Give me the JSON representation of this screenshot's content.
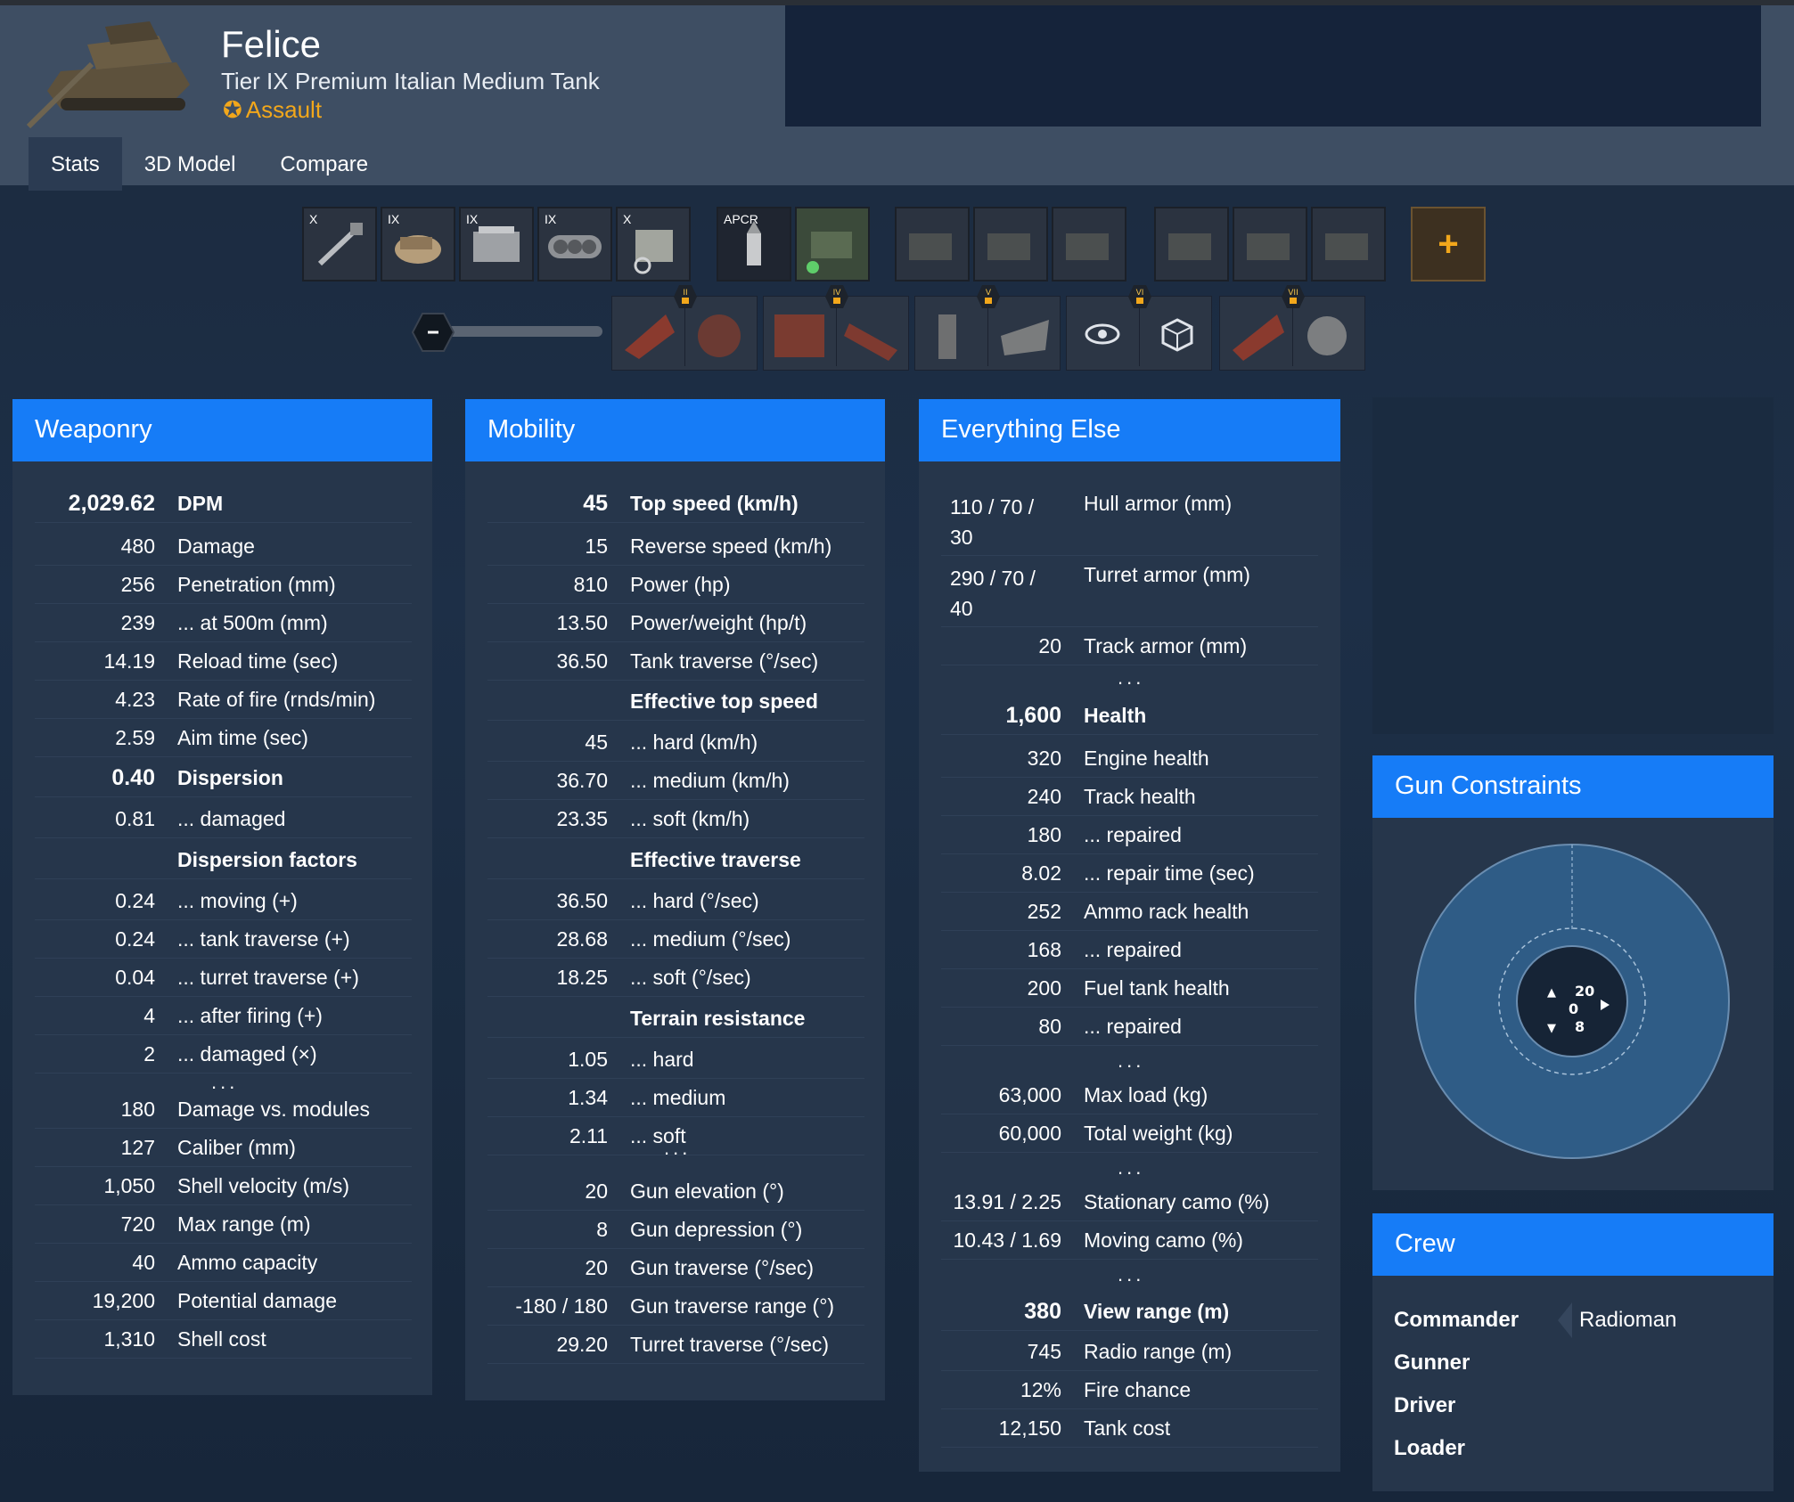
{
  "header": {
    "name": "Felice",
    "subtitle": "Tier IX Premium Italian Medium Tank",
    "role": "Assault"
  },
  "tabs": [
    "Stats",
    "3D Model",
    "Compare"
  ],
  "loadout": {
    "modules": [
      {
        "tier": "X",
        "icon": "gun-icon"
      },
      {
        "tier": "IX",
        "icon": "turret-icon"
      },
      {
        "tier": "IX",
        "icon": "engine-icon"
      },
      {
        "tier": "IX",
        "icon": "suspension-icon"
      },
      {
        "tier": "X",
        "icon": "radio-icon"
      }
    ],
    "shell": {
      "label": "APCR",
      "icon": "shell-icon"
    },
    "consumable_slots": 7,
    "add_label": "+",
    "skill_badges": [
      "II",
      "IV",
      "V",
      "VI",
      "VII"
    ]
  },
  "weaponry": {
    "title": "Weaponry",
    "rows": [
      {
        "v": "2,029.62",
        "l": "DPM",
        "b": true
      },
      {
        "v": "480",
        "l": "Damage"
      },
      {
        "v": "256",
        "l": "Penetration (mm)"
      },
      {
        "v": "239",
        "l": "... at 500m (mm)"
      },
      {
        "v": "14.19",
        "l": "Reload time (sec)"
      },
      {
        "v": "4.23",
        "l": "Rate of fire (rnds/min)"
      },
      {
        "v": "2.59",
        "l": "Aim time (sec)"
      },
      {
        "v": "0.40",
        "l": "Dispersion",
        "b": true
      },
      {
        "v": "0.81",
        "l": "... damaged"
      },
      {
        "v": "",
        "l": "Dispersion factors",
        "b": true
      },
      {
        "v": "0.24",
        "l": "... moving (+)"
      },
      {
        "v": "0.24",
        "l": "... tank traverse (+)"
      },
      {
        "v": "0.04",
        "l": "... turret traverse (+)"
      },
      {
        "v": "4",
        "l": "... after firing (+)"
      },
      {
        "v": "2",
        "l": "... damaged (×)"
      },
      {
        "v": "180",
        "l": "Damage vs. modules"
      },
      {
        "v": "127",
        "l": "Caliber (mm)"
      },
      {
        "v": "1,050",
        "l": "Shell velocity (m/s)"
      },
      {
        "v": "720",
        "l": "Max range (m)"
      },
      {
        "v": "40",
        "l": "Ammo capacity"
      },
      {
        "v": "19,200",
        "l": "Potential damage"
      },
      {
        "v": "1,310",
        "l": "Shell cost"
      }
    ]
  },
  "mobility": {
    "title": "Mobility",
    "rows": [
      {
        "v": "45",
        "l": "Top speed (km/h)",
        "b": true
      },
      {
        "v": "15",
        "l": "Reverse speed (km/h)"
      },
      {
        "v": "810",
        "l": "Power (hp)"
      },
      {
        "v": "13.50",
        "l": "Power/weight (hp/t)"
      },
      {
        "v": "36.50",
        "l": "Tank traverse (°/sec)"
      },
      {
        "v": "",
        "l": "Effective top speed",
        "b": true
      },
      {
        "v": "45",
        "l": "... hard (km/h)"
      },
      {
        "v": "36.70",
        "l": "... medium (km/h)"
      },
      {
        "v": "23.35",
        "l": "... soft (km/h)"
      },
      {
        "v": "",
        "l": "Effective traverse",
        "b": true
      },
      {
        "v": "36.50",
        "l": "... hard (°/sec)"
      },
      {
        "v": "28.68",
        "l": "... medium (°/sec)"
      },
      {
        "v": "18.25",
        "l": "... soft (°/sec)"
      },
      {
        "v": "",
        "l": "Terrain resistance",
        "b": true
      },
      {
        "v": "1.05",
        "l": "... hard"
      },
      {
        "v": "1.34",
        "l": "... medium"
      },
      {
        "v": "2.11",
        "l": "... soft"
      },
      {
        "v": "20",
        "l": "Gun elevation (°)"
      },
      {
        "v": "8",
        "l": "Gun depression (°)"
      },
      {
        "v": "20",
        "l": "Gun traverse (°/sec)"
      },
      {
        "v": "-180 / 180",
        "l": "Gun traverse range (°)"
      },
      {
        "v": "29.20",
        "l": "Turret traverse (°/sec)"
      }
    ]
  },
  "else": {
    "title": "Everything Else",
    "rows": [
      {
        "v": "110 / 70 /",
        "v2": "30",
        "l": "Hull armor (mm)"
      },
      {
        "v": "290 / 70 /",
        "v2": "40",
        "l": "Turret armor (mm)"
      },
      {
        "v": "20",
        "l": "Track armor (mm)"
      },
      {
        "v": "1,600",
        "l": "Health",
        "b": true
      },
      {
        "v": "320",
        "l": "Engine health"
      },
      {
        "v": "240",
        "l": "Track health"
      },
      {
        "v": "180",
        "l": "... repaired"
      },
      {
        "v": "8.02",
        "l": "... repair time (sec)"
      },
      {
        "v": "252",
        "l": "Ammo rack health"
      },
      {
        "v": "168",
        "l": "... repaired"
      },
      {
        "v": "200",
        "l": "Fuel tank health"
      },
      {
        "v": "80",
        "l": "... repaired"
      },
      {
        "v": "63,000",
        "l": "Max load (kg)"
      },
      {
        "v": "60,000",
        "l": "Total weight (kg)"
      },
      {
        "v": "13.91 / 2.25",
        "l": "Stationary camo (%)"
      },
      {
        "v": "10.43 / 1.69",
        "l": "Moving camo (%)"
      },
      {
        "v": "380",
        "l": "View range (m)",
        "b": true
      },
      {
        "v": "745",
        "l": "Radio range (m)"
      },
      {
        "v": "12%",
        "l": "Fire chance"
      },
      {
        "v": "12,150",
        "l": "Tank cost"
      }
    ]
  },
  "gun_constraints": {
    "title": "Gun Constraints",
    "elevation": "20",
    "center": "0",
    "depression": "8"
  },
  "crew": {
    "title": "Crew",
    "roles": [
      "Commander",
      "Gunner",
      "Driver",
      "Loader"
    ],
    "commander_extra": "Radioman"
  },
  "ellipsis": "...",
  "colors": {
    "accent": "#167cf7",
    "card": "#26364b",
    "header": "#3e4e63",
    "role": "#f2a71b"
  }
}
